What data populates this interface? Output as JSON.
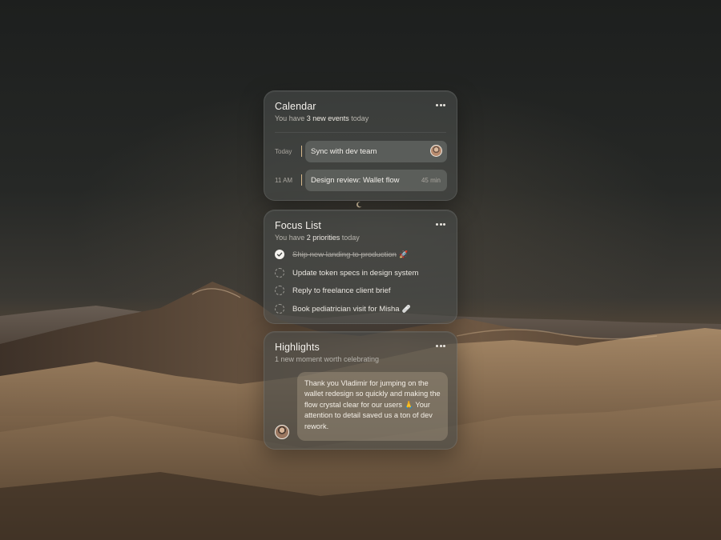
{
  "calendar": {
    "title": "Calendar",
    "subtitle_prefix": "You have ",
    "subtitle_highlight": "3 new events",
    "subtitle_suffix": " today",
    "more_icon": "more-horizontal-icon",
    "events": [
      {
        "time": "Today",
        "title": "Sync with dev team",
        "duration": "",
        "has_avatar": true
      },
      {
        "time": "11 AM",
        "title": "Design review: Wallet flow",
        "duration": "45 min",
        "has_avatar": false
      }
    ]
  },
  "focus": {
    "title": "Focus List",
    "subtitle_prefix": "You have ",
    "subtitle_highlight": "2 priorities",
    "subtitle_suffix": " today",
    "more_icon": "more-horizontal-icon",
    "tasks": [
      {
        "label": "Ship new landing to production",
        "emoji": "🚀",
        "done": true
      },
      {
        "label": "Update token specs in design system",
        "emoji": "",
        "done": false
      },
      {
        "label": "Reply to freelance client brief",
        "emoji": "",
        "done": false
      },
      {
        "label": "Book pediatrician visit for Misha",
        "emoji": "🩹",
        "done": false
      }
    ]
  },
  "highlights": {
    "title": "Highlights",
    "subtitle": "1 new moment worth celebrating",
    "more_icon": "more-horizontal-icon",
    "message": "Thank you Vladimir for jumping on the wallet redesign so quickly and making the flow crystal clear for our users 🙏 Your attention to detail saved us a ton of dev rework."
  },
  "colors": {
    "accent_bar": "#d8b98b",
    "card_bg": "rgba(72,76,74,0.62)",
    "bubble_bg": "rgba(196,178,152,0.30)"
  }
}
